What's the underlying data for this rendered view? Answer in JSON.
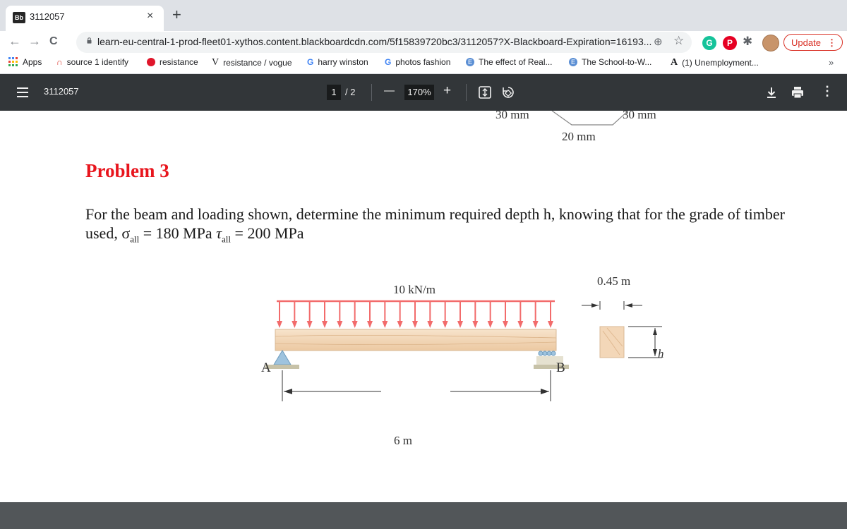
{
  "tab": {
    "favicon": "Bb",
    "title": "3112057",
    "close": "×",
    "new_tab": "+"
  },
  "toolbar": {
    "back": "←",
    "forward": "→",
    "reload": "C",
    "url": "learn-eu-central-1-prod-fleet01-xythos.content.blackboardcdn.com/5f15839720bc3/3112057?X-Blackboard-Expiration=16193...",
    "update_label": "Update",
    "ext_g": "G",
    "ext_p": "P"
  },
  "bookmarks": [
    {
      "label": "Apps"
    },
    {
      "label": "source 1 identify"
    },
    {
      "label": "resistance"
    },
    {
      "label": "resistance / vogue",
      "icon_letter": "V"
    },
    {
      "label": "harry winston",
      "icon_letter": "G"
    },
    {
      "label": "photos fashion",
      "icon_letter": "G"
    },
    {
      "label": "The effect of Real...",
      "icon_letter": "E"
    },
    {
      "label": "The School-to-W...",
      "icon_letter": "E"
    },
    {
      "label": "(1) Unemployment...",
      "icon_letter": "A"
    }
  ],
  "bookmarks_more": "»",
  "pdf": {
    "title": "3112057",
    "page_current": "1",
    "page_sep": "/ 2",
    "zoom": "170%",
    "minus": "—",
    "plus": "+"
  },
  "doc": {
    "top_dims": {
      "left": "30 mm",
      "right": "30 mm",
      "bottom": "20 mm"
    },
    "problem_title": "Problem 3",
    "problem_text": "For the beam and loading shown, determine the minimum required depth h, knowing that for the grade of timber used,",
    "sigma_symbol": "σ",
    "sigma_sub": "all",
    "sigma_value": " = 180 MPa",
    "tau_symbol": "τ",
    "tau_sub": "all",
    "tau_value": " = 200 MPa",
    "load_label": "10 kN/m",
    "support_a": "A",
    "support_b": "B",
    "span_label": "6 m",
    "width_label": "0.45 m",
    "depth_label": "h"
  },
  "colors": {
    "problem_title": "#e8151d",
    "load_arrows": "#f26b6b",
    "beam": "#f3d7b8",
    "support": "#9ec3de"
  }
}
